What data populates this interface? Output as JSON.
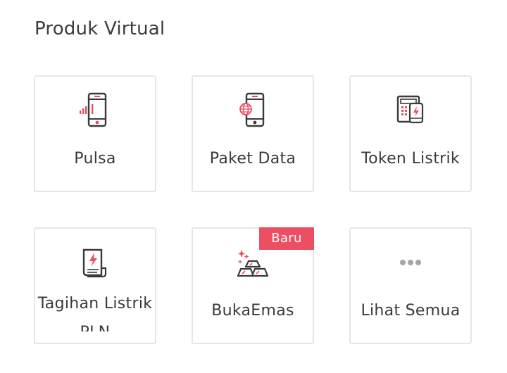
{
  "section": {
    "title": "Produk Virtual"
  },
  "products": [
    {
      "label": "Pulsa",
      "icon": "phone-signal-icon"
    },
    {
      "label": "Paket Data",
      "icon": "phone-globe-icon"
    },
    {
      "label": "Token Listrik",
      "icon": "meter-token-icon"
    },
    {
      "label": "Tagihan Listrik PLN",
      "icon": "electric-bill-icon"
    },
    {
      "label": "BukaEmas",
      "icon": "gold-bars-icon",
      "badge": "Baru"
    },
    {
      "label": "Lihat Semua",
      "icon": "more-dots-icon"
    }
  ],
  "colors": {
    "accent": "#ec4f63",
    "icon_stroke": "#3a3a3a",
    "card_border": "#e6e6e6"
  }
}
